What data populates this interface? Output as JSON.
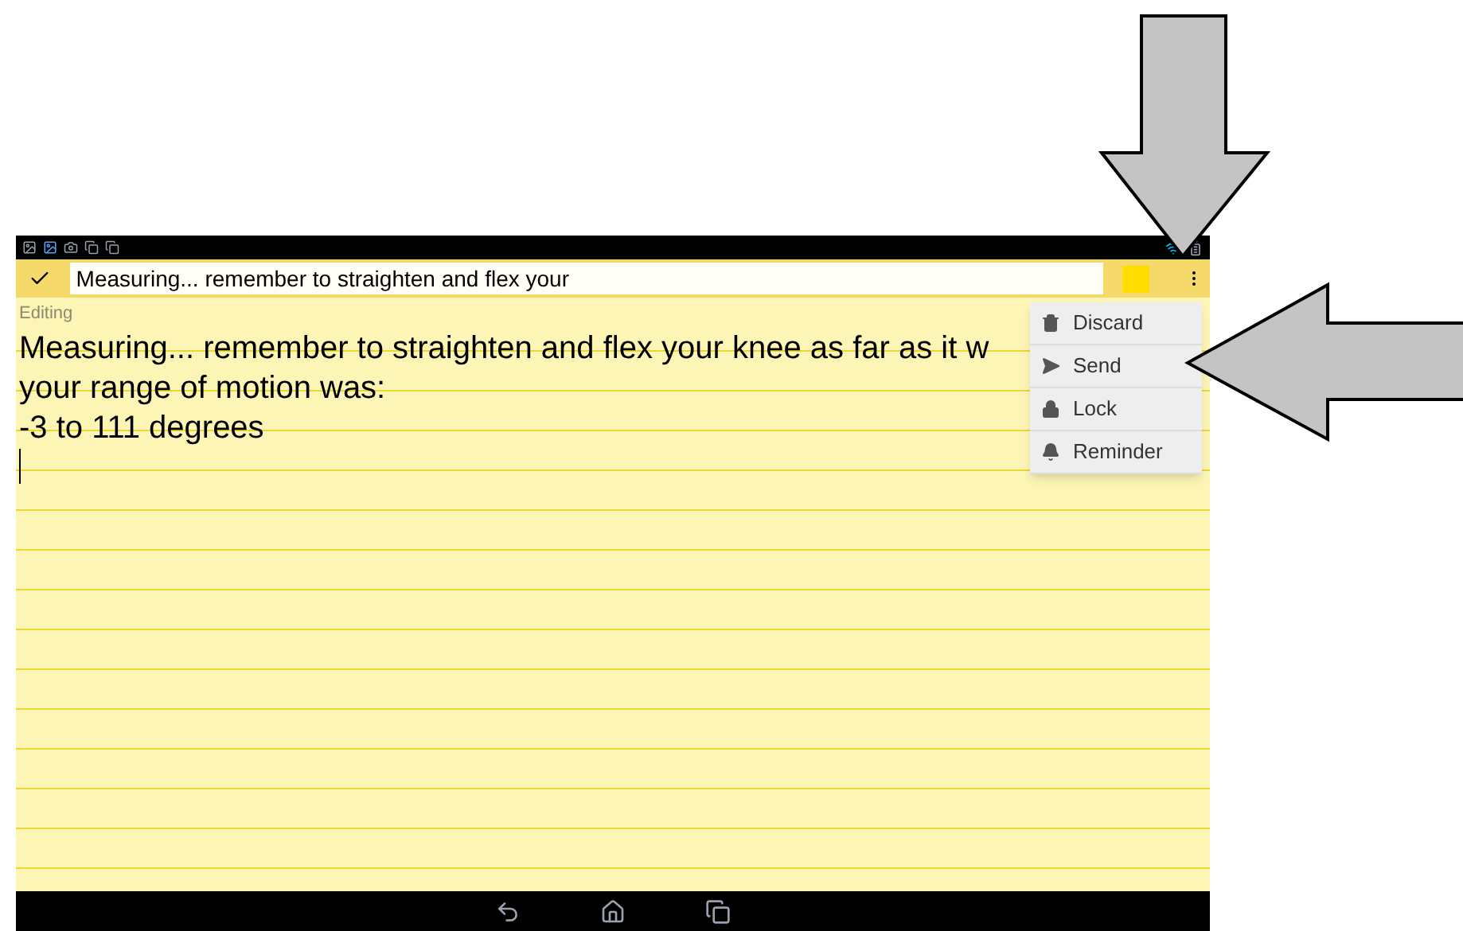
{
  "toolbar": {
    "title_field": "Measuring... remember to straighten and flex your",
    "color_swatch": {
      "color": "#ffdd00"
    }
  },
  "status": "Editing",
  "note_lines": [
    "Measuring... remember to straighten and flex your knee as far as it w",
    "your range of motion was:",
    "-3 to 111 degrees"
  ],
  "menu": [
    {
      "kind": "trash",
      "label": "Discard"
    },
    {
      "kind": "send",
      "label": "Send"
    },
    {
      "kind": "lock",
      "label": "Lock"
    },
    {
      "kind": "bell",
      "label": "Reminder"
    }
  ]
}
